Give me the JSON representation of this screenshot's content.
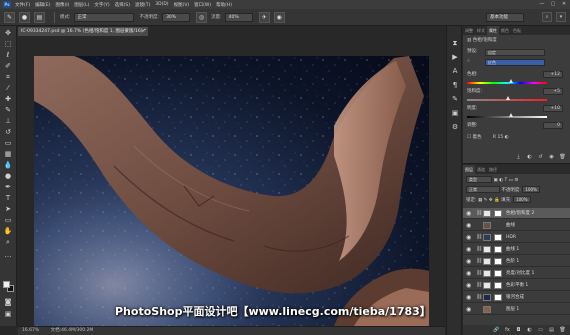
{
  "menubar": {
    "logo": "Ps",
    "items": [
      "文件(F)",
      "编辑(E)",
      "图像(I)",
      "图层(L)",
      "文字(Y)",
      "选择(S)",
      "滤镜(T)",
      "3D(D)",
      "视图(V)",
      "窗口(W)",
      "帮助(H)"
    ],
    "window_controls": [
      "—",
      "▢",
      "✕"
    ]
  },
  "options_bar": {
    "mode_label": "模式:",
    "mode_value": "正常",
    "opacity_label": "不透明度:",
    "opacity_value": "30%",
    "flow_label": "流量:",
    "flow_value": "40%",
    "workspace": "基本功能"
  },
  "document": {
    "tab_title": "IC-09334247.psd @ 16.7% (色相/饱和度 1, 图层蒙版/16) *",
    "close": "×"
  },
  "watermark": {
    "text": "PhotoShop平面设计吧【www.linecg.com/tieba/1783】"
  },
  "statusbar": {
    "zoom": "16.67%",
    "doc_info": "文档:46.4M/300.2M"
  },
  "properties_panel": {
    "tabs": [
      "调整",
      "样式",
      "属性",
      "颜色",
      "色板"
    ],
    "active_tab": "属性",
    "title": "色相/饱和度",
    "preset_label": "预设:",
    "preset_value": "自定",
    "channel_value": "红色",
    "hue_label": "色相:",
    "hue_value": "+12",
    "hue_level": 0.55,
    "saturation_label": "饱和度:",
    "saturation_value": "+5",
    "saturation_level": 0.52,
    "lightness_label": "明度:",
    "lightness_value": "+10",
    "lightness_level": 0.55,
    "extra_label": "调整:",
    "extra_value": "0",
    "colorize_label": "着色",
    "range_label": "R 15 ◐"
  },
  "layers_panel": {
    "tabs": [
      "图层",
      "通道",
      "路径"
    ],
    "filter_label": "类型",
    "blend_mode": "正常",
    "opacity_label": "不透明度:",
    "opacity_value": "100%",
    "lock_label": "锁定:",
    "fill_label": "填充:",
    "fill_value": "100%",
    "layers": [
      {
        "name": "色相/饱和度 2",
        "thumb_color": "#e8e8e8",
        "has_mask": true,
        "selected": true
      },
      {
        "name": "曲线",
        "thumb_color": "#6a5044",
        "has_mask": false,
        "selected": false
      },
      {
        "name": "HDR",
        "thumb_color": "#2a3a5a",
        "has_mask": true,
        "selected": false
      },
      {
        "name": "曲线 1",
        "thumb_color": "#e8e8e8",
        "has_mask": true,
        "selected": false
      },
      {
        "name": "色阶 1",
        "thumb_color": "#e8e8e8",
        "has_mask": true,
        "selected": false
      },
      {
        "name": "亮度/对比度 1",
        "thumb_color": "#e8e8e8",
        "has_mask": true,
        "selected": false
      },
      {
        "name": "色彩平衡 1",
        "thumb_color": "#e8e8e8",
        "has_mask": true,
        "selected": false
      },
      {
        "name": "银河合成",
        "thumb_color": "#1c2a48",
        "has_mask": true,
        "selected": false
      },
      {
        "name": "图层 1",
        "thumb_color": "#8a6048",
        "has_mask": false,
        "selected": false
      }
    ]
  }
}
